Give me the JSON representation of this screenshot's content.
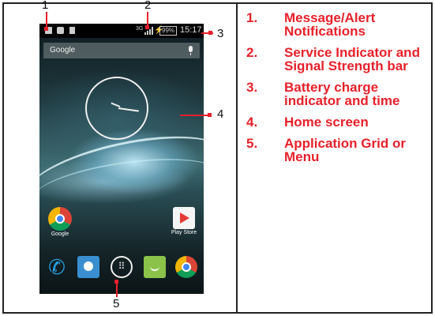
{
  "phone": {
    "status_bar": {
      "signal_tag": "3G",
      "battery": "99%",
      "time": "15:17"
    },
    "search_label": "Google",
    "apps": [
      {
        "label": "Google"
      },
      {
        "label": "Play Store"
      }
    ],
    "dock_icons": [
      "phone-icon",
      "contacts-icon",
      "app-grid-icon",
      "messaging-icon",
      "chrome-icon"
    ]
  },
  "callouts": [
    "1",
    "2",
    "3",
    "4",
    "5"
  ],
  "legend": [
    {
      "num": "1.",
      "text": "Message/Alert Notifications"
    },
    {
      "num": "2.",
      "text": "Service Indicator and Signal Strength bar"
    },
    {
      "num": "3.",
      "text": "Battery charge indicator and time"
    },
    {
      "num": "4.",
      "text": "Home screen"
    },
    {
      "num": "5.",
      "text": "Application Grid or Menu"
    }
  ],
  "colors": {
    "accent": "#e8202a",
    "border": "#222222"
  }
}
